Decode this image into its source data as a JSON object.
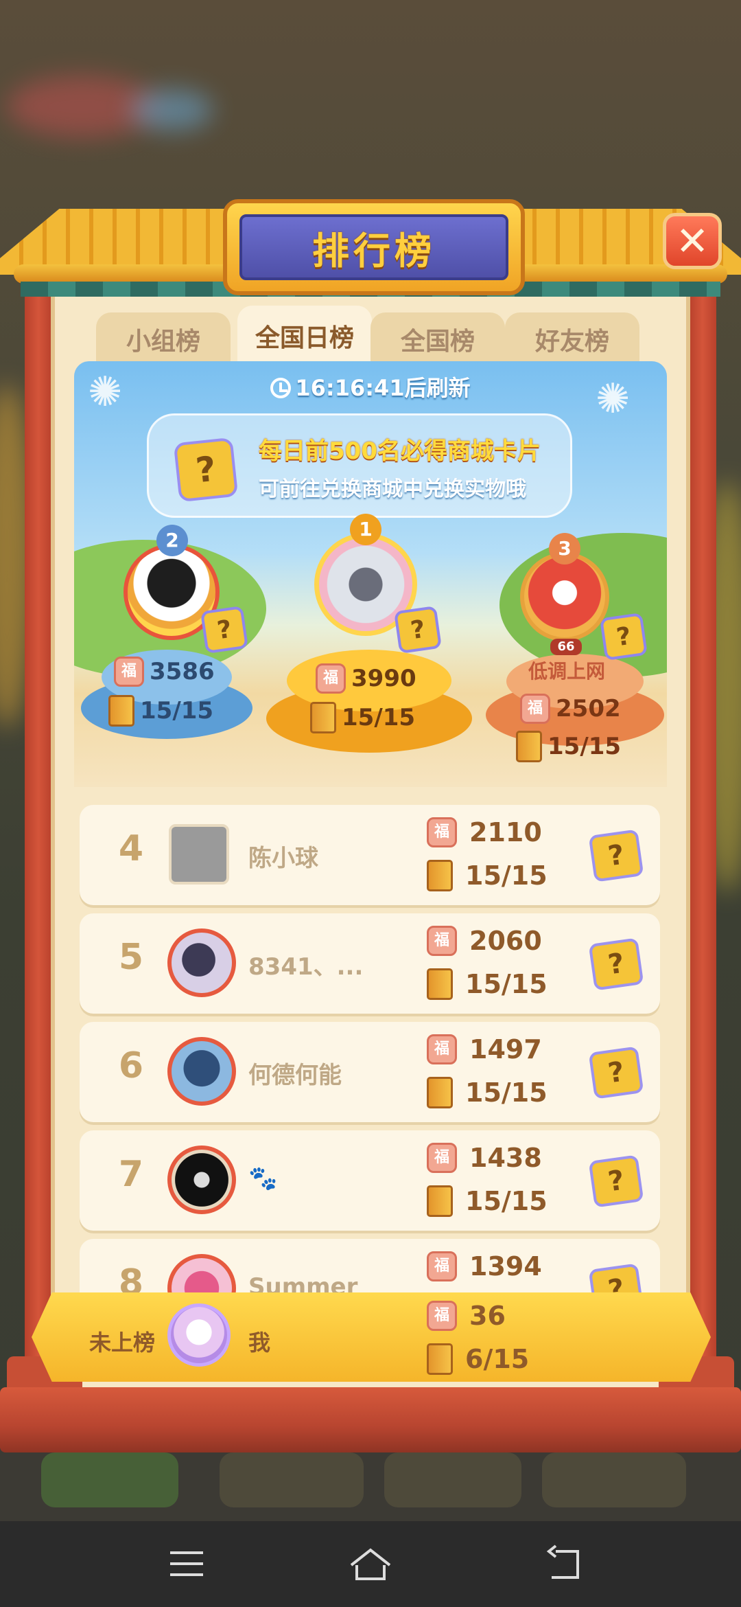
{
  "title": "排行榜",
  "close_label": "✕",
  "tabs": [
    {
      "label": "小组榜",
      "active": false
    },
    {
      "label": "全国日榜",
      "active": true
    },
    {
      "label": "全国榜",
      "active": false
    },
    {
      "label": "好友榜",
      "active": false
    }
  ],
  "refresh": {
    "time": "16:16:41",
    "suffix": "后刷新"
  },
  "banner": {
    "line1": "每日前500名必得商城卡片",
    "line2": "可前往兑换商城中兑换实物哦",
    "card_label": "?"
  },
  "podium": [
    {
      "rank": "2",
      "score": "3586",
      "progress": "15/15"
    },
    {
      "rank": "1",
      "score": "3990",
      "progress": "15/15"
    },
    {
      "rank": "3",
      "score": "2502",
      "progress": "15/15",
      "caption": "低调上网",
      "level": "66"
    }
  ],
  "fu_label": "福",
  "rows": [
    {
      "rank": "4",
      "name": "陈小球",
      "score": "2110",
      "progress": "15/15"
    },
    {
      "rank": "5",
      "name": "8341、...",
      "score": "2060",
      "progress": "15/15"
    },
    {
      "rank": "6",
      "name": "何德何能",
      "score": "1497",
      "progress": "15/15"
    },
    {
      "rank": "7",
      "name": "🐾",
      "score": "1438",
      "progress": "15/15"
    },
    {
      "rank": "8",
      "name": "Summer",
      "score": "1394",
      "progress": ""
    }
  ],
  "me": {
    "rank": "未上榜",
    "name": "我",
    "score": "36",
    "progress": "6/15"
  },
  "colors": {
    "accent": "#f5b52a",
    "panel": "#f7e8c7",
    "frame": "#c74f35"
  }
}
